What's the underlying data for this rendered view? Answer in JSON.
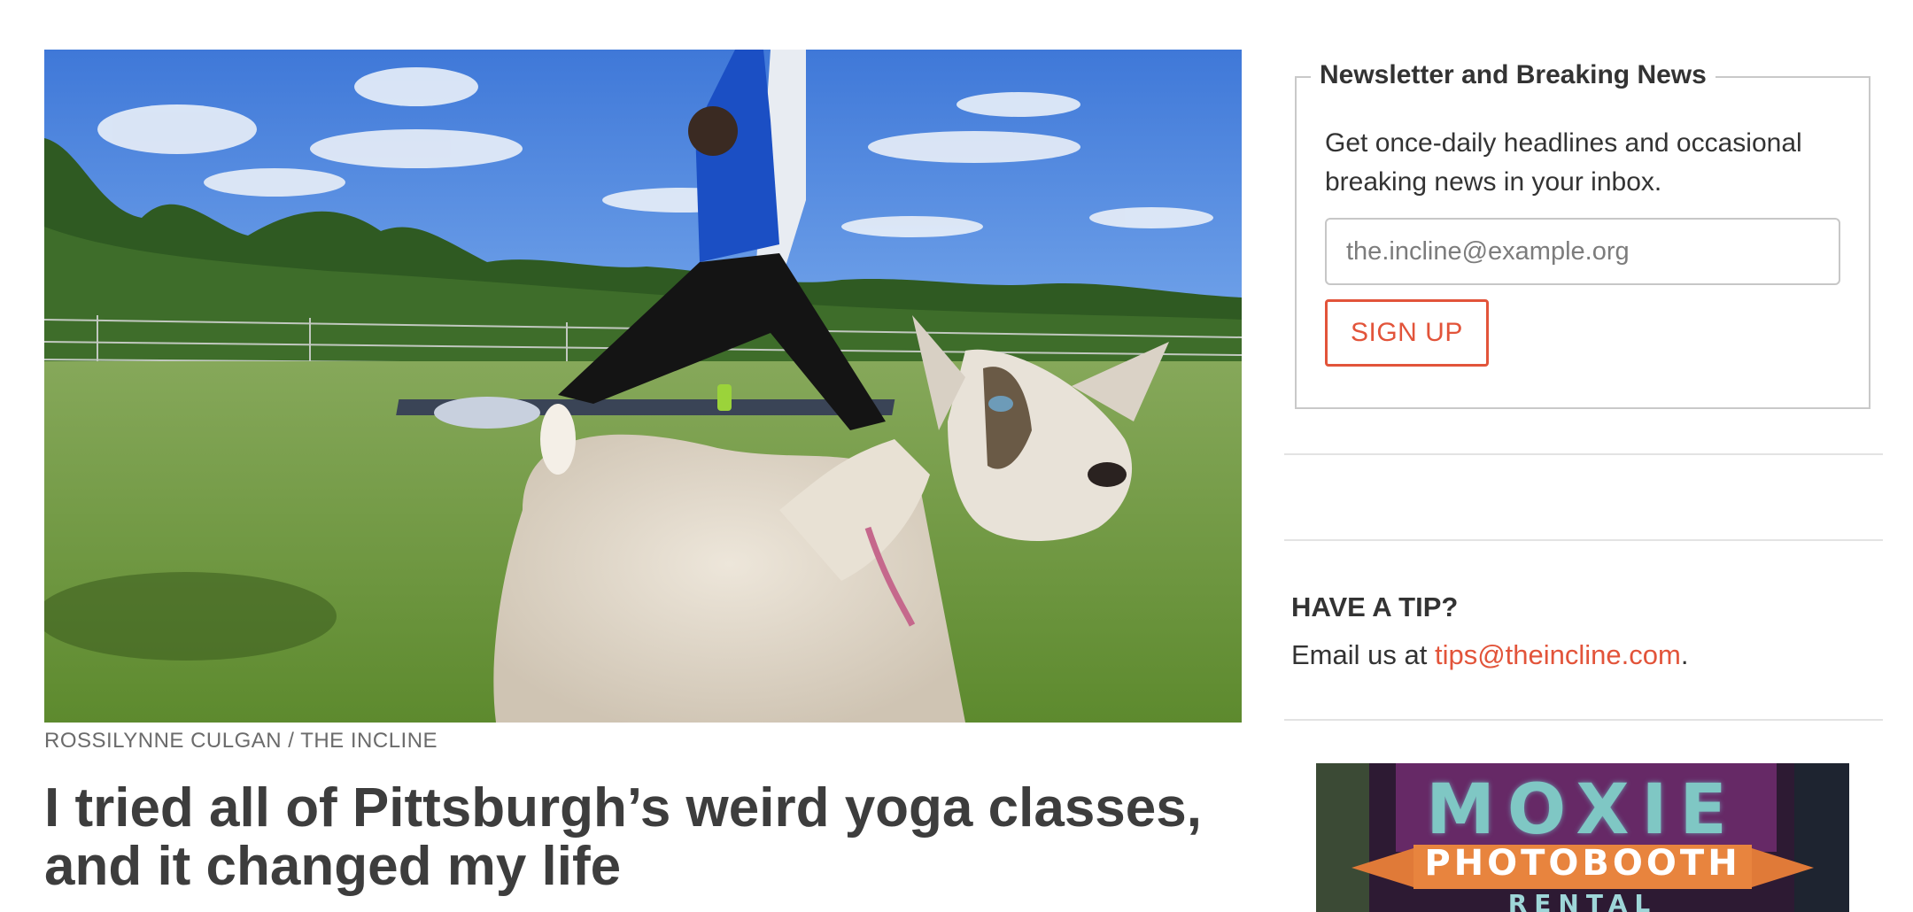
{
  "article": {
    "photo_credit": "ROSSILYNNE CULGAN / THE INCLINE",
    "headline": "I tried all of Pittsburgh’s weird yoga classes, and it changed my life",
    "hero_image": "goat-yoga-photo"
  },
  "newsletter": {
    "title": "Newsletter and Breaking News",
    "description": "Get once-daily headlines and occasional breaking news in your inbox.",
    "email_placeholder": "the.incline@example.org",
    "email_value": "",
    "signup_label": "SIGN UP"
  },
  "tip": {
    "heading": "HAVE A TIP?",
    "prefix": "Email us at ",
    "email": "tips@theincline.com",
    "suffix": "."
  },
  "ad": {
    "line1": "MOXIE",
    "line2": "PHOTOBOOTH",
    "line3": "RENTAL"
  },
  "colors": {
    "accent": "#e2543a",
    "text": "#333333",
    "muted": "#6b6b6b",
    "border": "#c9c9c9"
  }
}
